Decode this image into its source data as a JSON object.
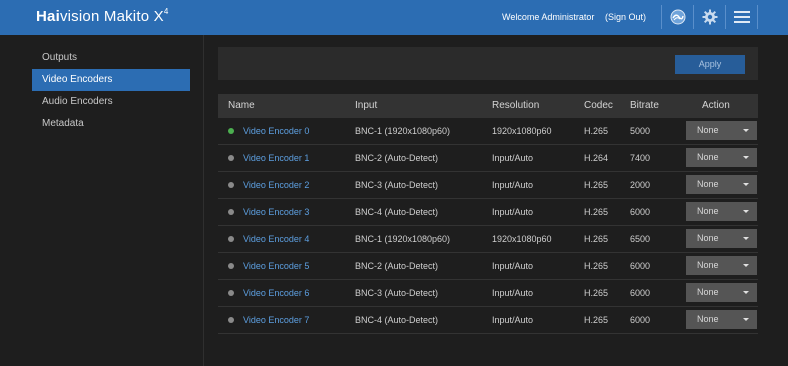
{
  "header": {
    "logo_bold": "Hai",
    "logo_rest": "vision Makito X",
    "logo_sup": "4",
    "welcome": "Welcome Administrator",
    "signout": "(Sign Out)",
    "icons": [
      "network-icon",
      "gear-icon",
      "menu-icon"
    ],
    "bg_color": "#2c6db3"
  },
  "sidebar": {
    "items": [
      {
        "label": "Outputs",
        "active": false
      },
      {
        "label": "Video Encoders",
        "active": true
      },
      {
        "label": "Audio Encoders",
        "active": false
      },
      {
        "label": "Metadata",
        "active": false
      }
    ]
  },
  "toolbar": {
    "apply_label": "Apply"
  },
  "table": {
    "columns": [
      "Name",
      "Input",
      "Resolution",
      "Codec",
      "Bitrate",
      "Action"
    ],
    "rows": [
      {
        "name": "Video Encoder 0",
        "input": "BNC-1 (1920x1080p60)",
        "resolution": "1920x1080p60",
        "codec": "H.265",
        "bitrate": "5000",
        "action": "None",
        "running": true
      },
      {
        "name": "Video Encoder 1",
        "input": "BNC-2 (Auto-Detect)",
        "resolution": "Input/Auto",
        "codec": "H.264",
        "bitrate": "7400",
        "action": "None",
        "running": false
      },
      {
        "name": "Video Encoder 2",
        "input": "BNC-3 (Auto-Detect)",
        "resolution": "Input/Auto",
        "codec": "H.265",
        "bitrate": "2000",
        "action": "None",
        "running": false
      },
      {
        "name": "Video Encoder 3",
        "input": "BNC-4 (Auto-Detect)",
        "resolution": "Input/Auto",
        "codec": "H.265",
        "bitrate": "6000",
        "action": "None",
        "running": false
      },
      {
        "name": "Video Encoder 4",
        "input": "BNC-1 (1920x1080p60)",
        "resolution": "1920x1080p60",
        "codec": "H.265",
        "bitrate": "6500",
        "action": "None",
        "running": false
      },
      {
        "name": "Video Encoder 5",
        "input": "BNC-2 (Auto-Detect)",
        "resolution": "Input/Auto",
        "codec": "H.265",
        "bitrate": "6000",
        "action": "None",
        "running": false
      },
      {
        "name": "Video Encoder 6",
        "input": "BNC-3 (Auto-Detect)",
        "resolution": "Input/Auto",
        "codec": "H.265",
        "bitrate": "6000",
        "action": "None",
        "running": false
      },
      {
        "name": "Video Encoder 7",
        "input": "BNC-4 (Auto-Detect)",
        "resolution": "Input/Auto",
        "codec": "H.265",
        "bitrate": "6000",
        "action": "None",
        "running": false
      }
    ]
  },
  "colors": {
    "accent": "#2c6db3",
    "link": "#5d9fe0",
    "status_running": "#4caf50",
    "status_idle": "#8a8a8a"
  }
}
